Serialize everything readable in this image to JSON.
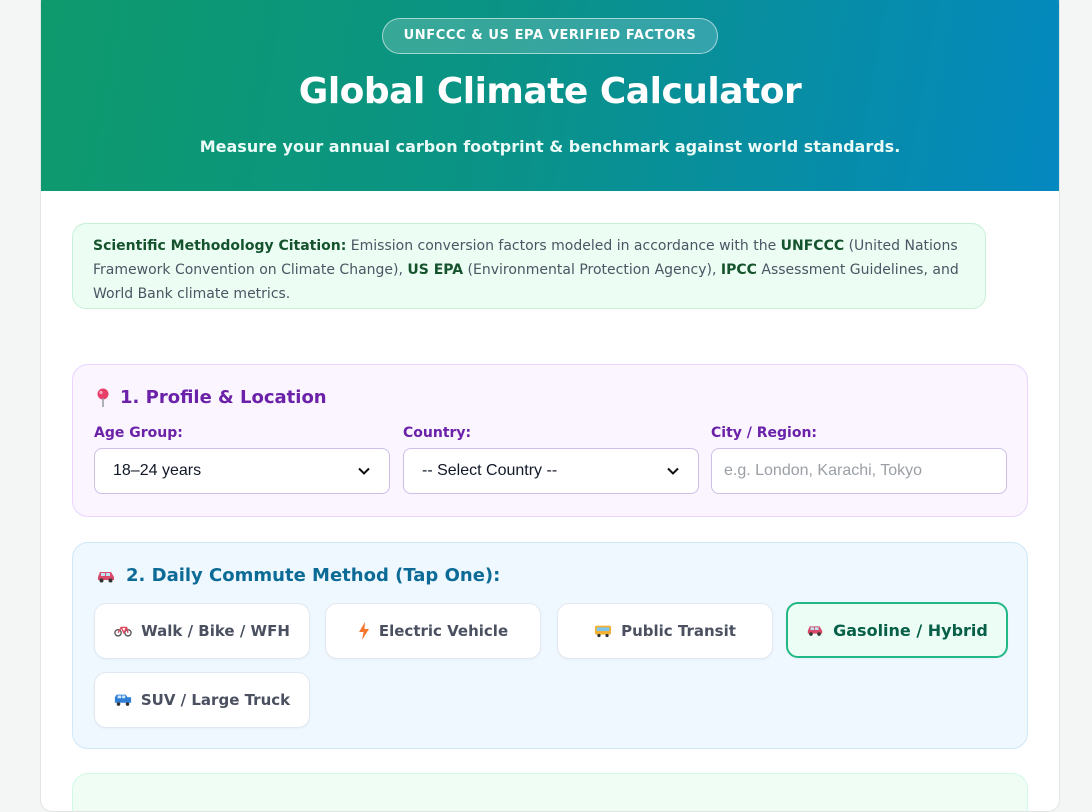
{
  "header": {
    "badge": "UNFCCC & US EPA VERIFIED FACTORS",
    "title": "Global Climate Calculator",
    "subtitle": "Measure your annual carbon footprint & benchmark against world standards."
  },
  "citation": {
    "lead": "Scientific Methodology Citation:",
    "t1": " Emission conversion factors modeled in accordance with the ",
    "b1": "UNFCCC",
    "t2": " (United Nations Framework Convention on Climate Change), ",
    "b2": "US EPA",
    "t3": " (Environmental Protection Agency), ",
    "b3": "IPCC",
    "t4": " Assessment Guidelines, and World Bank climate metrics."
  },
  "profile": {
    "icon": "pin-icon",
    "title": "1. Profile & Location",
    "age_label": "Age Group:",
    "age_value": "18–24 years",
    "country_label": "Country:",
    "country_value": "-- Select Country --",
    "city_label": "City / Region:",
    "city_placeholder": "e.g. London, Karachi, Tokyo"
  },
  "commute": {
    "icon": "car-icon",
    "title": "2. Daily Commute Method (Tap One):",
    "options": [
      {
        "label": "Walk / Bike / WFH",
        "icon": "bicycle-icon",
        "selected": false
      },
      {
        "label": "Electric Vehicle",
        "icon": "lightning-icon",
        "selected": false
      },
      {
        "label": "Public Transit",
        "icon": "bus-icon",
        "selected": false
      },
      {
        "label": "Gasoline / Hybrid",
        "icon": "car-icon",
        "selected": true
      },
      {
        "label": "SUV / Large Truck",
        "icon": "suv-icon",
        "selected": false
      }
    ]
  },
  "colors": {
    "accent_green": "#22b886",
    "profile_purple": "#6b21a8",
    "commute_blue": "#0c6b96",
    "hero_start": "#0e9a6c",
    "hero_end": "#0488c0"
  }
}
